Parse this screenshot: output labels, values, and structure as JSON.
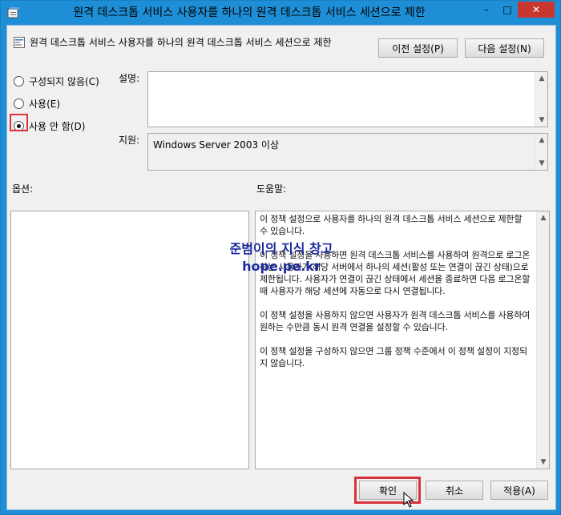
{
  "window": {
    "title": "원격 데스크톱 서비스 사용자를 하나의 원격 데스크톱 서비스 세션으로 제한",
    "controls": {
      "minimize": "–",
      "maximize": "□",
      "close": "✕"
    }
  },
  "header": {
    "policy_name": "원격 데스크톱 서비스 사용자를 하나의 원격 데스크톱 서비스 세션으로 제한",
    "prev_setting": "이전 설정(P)",
    "next_setting": "다음 설정(N)"
  },
  "radios": {
    "not_configured": "구성되지 않음(C)",
    "enabled": "사용(E)",
    "disabled": "사용 안 함(D)",
    "selected": "disabled"
  },
  "labels": {
    "comment": "설명:",
    "supported_on": "지원:",
    "options": "옵션:",
    "help": "도움말:"
  },
  "supported_value": "Windows Server 2003 이상",
  "help_text": "이 정책 설정으로 사용자를 하나의 원격 데스크톱 서비스 세션으로 제한할 수 있습니다.\n\n이 정책 설정을 사용하면 원격 데스크톱 서비스를 사용하여 원격으로 로그온하는 사용자가 해당 서버에서 하나의 세션(활성 또는 연결이 끊긴 상태)으로 제한됩니다. 사용자가 연결이 끊긴 상태에서 세션을 종료하면 다음 로그온할 때 사용자가 해당 세션에 자동으로 다시 연결됩니다.\n\n이 정책 설정을 사용하지 않으면 사용자가 원격 데스크톱 서비스를 사용하여 원하는 수만큼 동시 원격 연결을 설정할 수 있습니다.\n\n이 정책 설정을 구성하지 않으면 그룹 정책 수준에서 이 정책 설정이 지정되지 않습니다.",
  "watermark": {
    "line1": "준범이의 지식 창고",
    "line2": "hope.pe.kr"
  },
  "footer": {
    "ok": "확인",
    "cancel": "취소",
    "apply": "적용(A)"
  },
  "colors": {
    "titlebar": "#1e8fd6",
    "close_button": "#c7372f",
    "highlight": "#e0303a"
  }
}
